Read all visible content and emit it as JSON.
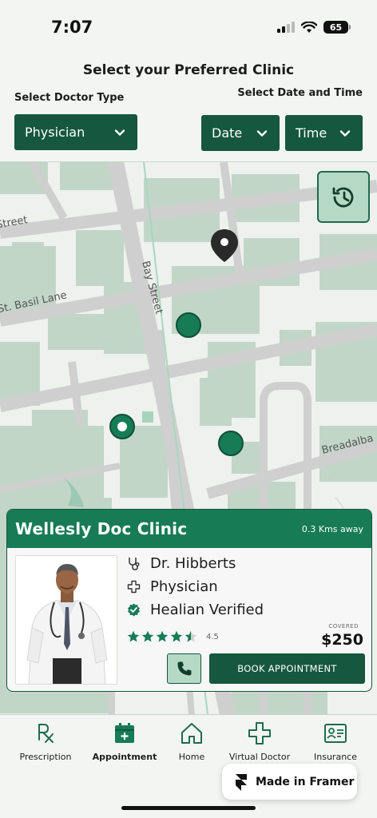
{
  "status_bar": {
    "time": "7:07",
    "battery": "65"
  },
  "header": {
    "title": "Select your Preferred Clinic",
    "doctor_type_label": "Select Doctor Type",
    "date_time_label": "Select Date and Time",
    "doctor_type_value": "Physician",
    "date_value": "Date",
    "time_value": "Time"
  },
  "map": {
    "street_labels": [
      "Street",
      "St. Basil Lane",
      "Bay Street",
      "Breadalba"
    ]
  },
  "clinic_card": {
    "name": "Wellesly Doc Clinic",
    "distance": "0.3 Kms away",
    "doctor_name": "Dr. Hibberts",
    "doctor_type": "Physician",
    "verified": "Healian Verified",
    "rating": 4.5,
    "rating_text": "4.5",
    "covered_label": "COVERED",
    "price": "$250",
    "book_label": "BOOK APPOINTMENT"
  },
  "nav": {
    "items": [
      {
        "label": "Prescription",
        "icon": "prescription-icon"
      },
      {
        "label": "Appointment",
        "icon": "calendar-icon",
        "active": true
      },
      {
        "label": "Home",
        "icon": "home-icon"
      },
      {
        "label": "Virtual Doctor",
        "icon": "medical-cross-icon"
      },
      {
        "label": "Insurance",
        "icon": "id-card-icon"
      }
    ]
  },
  "framer_badge": "Made in Framer",
  "colors": {
    "primary": "#15573f",
    "header_green": "#177b55",
    "accent_light": "#b6d9c6",
    "map_land": "#eef1ee",
    "map_block": "#c2d6c8",
    "map_road": "#cfcfcf"
  }
}
